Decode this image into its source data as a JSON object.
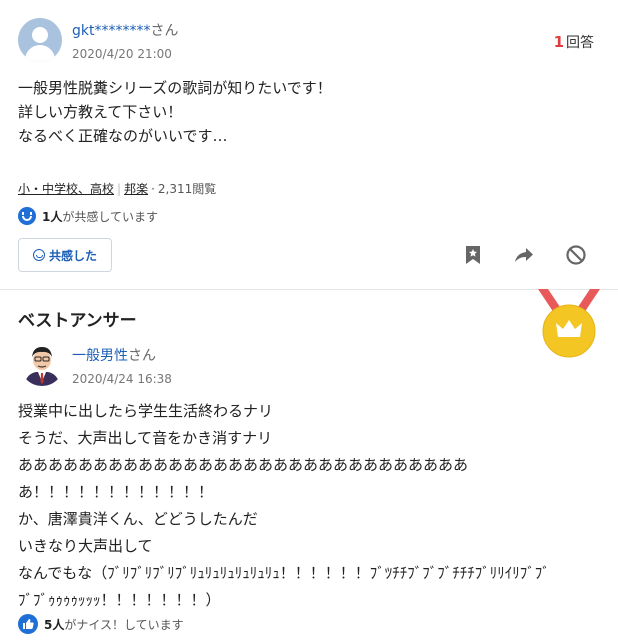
{
  "question": {
    "user_name": "gkt********",
    "user_suffix": "さん",
    "date": "2020/4/20 21:00",
    "answer_count": "1",
    "answer_label": "回答",
    "body_lines": [
      "一般男性脱糞シリーズの歌詞が知りたいです！",
      "詳しい方教えて下さい！",
      "なるべく正確なのがいいです…"
    ],
    "category_1": "小・中学校、高校",
    "category_2": "邦楽",
    "views": "2,311閲覧",
    "empathy_count": "1人",
    "empathy_text": "が共感しています",
    "empathy_button": "共感した",
    "icons": [
      "bookmark-icon",
      "share-icon",
      "block-icon"
    ]
  },
  "best_answer": {
    "title": "ベストアンサー",
    "user_name": "一般男性",
    "user_suffix": "さん",
    "date": "2020/4/24 16:38",
    "body_lines": [
      "授業中に出したら学生生活終わるナリ",
      "そうだ、大声出して音をかき消すナリ",
      "ああああああああああああああああああああああああああああああ",
      "あ！！！！！！！！！！！！",
      "か、唐澤貴洋くん、どどうしたんだ",
      "いきなり大声出して",
      "なんでもな（ﾌﾞﾘﾌﾞﾘﾌﾞﾘﾌﾞﾘｭﾘｭﾘｭﾘｭﾘｭﾘｭ！！！！！！ﾌﾞﾂﾁﾁﾌﾞﾌﾞﾌﾞﾁﾁﾁﾌﾞﾘﾘｲﾘﾌﾞﾌﾞ",
      "ﾌﾞﾌﾞｩｩｩｩｯｯｯ！！！！！！！）"
    ],
    "nice_count": "5人",
    "nice_text": "がナイス！しています",
    "colors": {
      "medal": "#f3c623",
      "ribbon": "#e85a5a",
      "accent": "#1f6fd6"
    }
  }
}
